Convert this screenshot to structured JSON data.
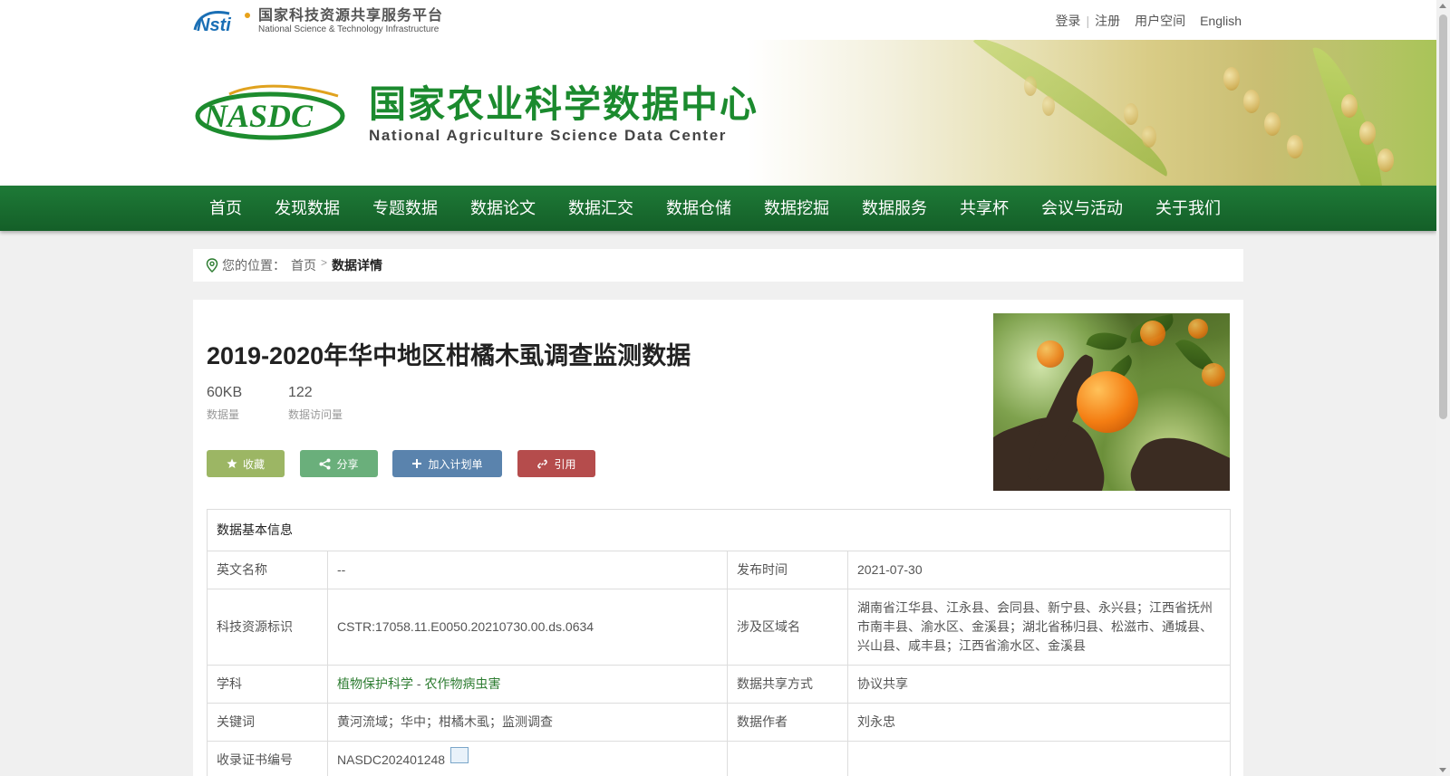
{
  "header": {
    "nsti_cn": "国家科技资源共享服务平台",
    "nsti_en": "National Science & Technology Infrastructure",
    "links": [
      "登录",
      "注册",
      "用户空间",
      "English"
    ]
  },
  "banner": {
    "title_cn": "国家农业科学数据中心",
    "title_en": "National Agriculture Science Data Center"
  },
  "nav": [
    "首页",
    "发现数据",
    "专题数据",
    "数据论文",
    "数据汇交",
    "数据仓储",
    "数据挖掘",
    "数据服务",
    "共享杯",
    "会议与活动",
    "关于我们"
  ],
  "breadcrumb": {
    "prefix": "您的位置：",
    "home": "首页",
    "current": "数据详情"
  },
  "dataset": {
    "title": "2019-2020年华中地区柑橘木虱调查监测数据",
    "size_value": "60KB",
    "size_label": "数据量",
    "visits_value": "122",
    "visits_label": "数据访问量"
  },
  "buttons": {
    "favorite": "收藏",
    "share": "分享",
    "add_plan": "加入计划单",
    "cite": "引用"
  },
  "info": {
    "header": "数据基本信息",
    "rows": [
      {
        "l1": "英文名称",
        "v1": "--",
        "l2": "发布时间",
        "v2": "2021-07-30"
      },
      {
        "l1": "科技资源标识",
        "v1": "CSTR:17058.11.E0050.20210730.00.ds.0634",
        "l2": "涉及区域名",
        "v2": "湖南省江华县、江永县、会同县、新宁县、永兴县；江西省抚州市南丰县、渝水区、金溪县；湖北省秭归县、松滋市、通城县、兴山县、咸丰县；江西省渝水区、金溪县"
      },
      {
        "l1": "学科",
        "v1_a": "植物保护科学",
        "v1_sep": " - ",
        "v1_b": "农作物病虫害",
        "l2": "数据共享方式",
        "v2": "协议共享"
      },
      {
        "l1": "关键词",
        "v1": "黄河流域；华中；柑橘木虱；监测调查",
        "l2": "数据作者",
        "v2": "刘永忠"
      },
      {
        "l1": "收录证书编号",
        "v1": "NASDC202401248",
        "l2": "",
        "v2": ""
      }
    ]
  }
}
